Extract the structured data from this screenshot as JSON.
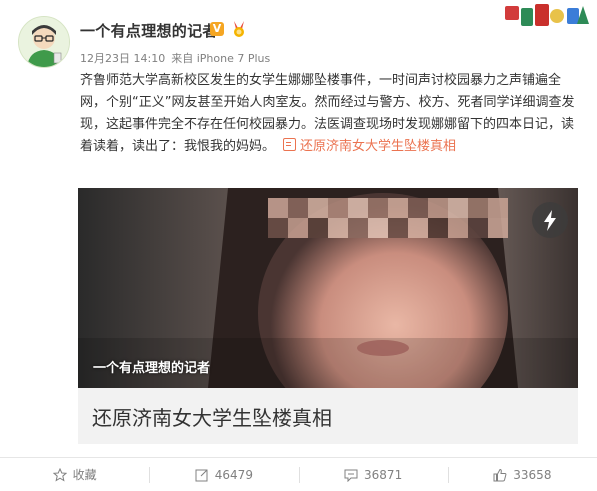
{
  "post": {
    "username": "一个有点理想的记者",
    "verified_badge": "V",
    "badge_icon": "medal-icon",
    "meta": {
      "time": "12月23日 14:10",
      "source_prefix": "来自",
      "device": "iPhone 7 Plus"
    },
    "content_text": "齐鲁师范大学高新校区发生的女学生娜娜坠楼事件，一时间声讨校园暴力之声铺遍全网，个别“正义”网友甚至开始人肉室友。然而经过与警方、校方、死者同学详细调查发现，这起事件完全不存在任何校园暴力。法医调查现场时发现娜娜留下的四本日记，读着读着，读出了：我恨我的妈妈。",
    "content_link": "还原济南女大学生坠楼真相",
    "link_icon": "article-icon",
    "media": {
      "watermark": "一个有点理想的记者",
      "title": "还原济南女大学生坠楼真相",
      "corner_icon": "lightning-icon"
    }
  },
  "actions": [
    {
      "label": "收藏",
      "icon": "star-icon"
    },
    {
      "label": "46479",
      "icon": "repost-icon"
    },
    {
      "label": "36871",
      "icon": "comment-icon"
    },
    {
      "label": "33658",
      "icon": "thumbs-up-icon"
    }
  ],
  "colors": {
    "link": "#eb7350",
    "meta": "#808080",
    "verified": "#f5a623"
  }
}
